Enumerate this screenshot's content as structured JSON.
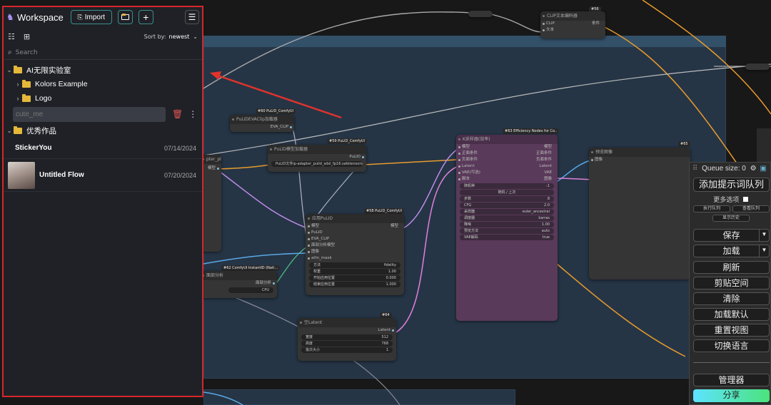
{
  "sidebar": {
    "title": "Workspace",
    "import_label": "Import",
    "sort_label": "Sort by:",
    "sort_value": "newest",
    "search_placeholder": "Search",
    "folders": [
      {
        "label": "AI无限实验室"
      },
      {
        "label": "Kolors Example"
      },
      {
        "label": "Logo"
      },
      {
        "label": "优秀作品"
      }
    ],
    "rename_value": "cute_me",
    "flows": [
      {
        "name": "StickerYou",
        "date": "07/14/2024"
      },
      {
        "name": "Untitled Flow",
        "date": "07/20/2024"
      }
    ]
  },
  "nodes": {
    "clip_encode": {
      "badge": "#56",
      "title": "CLIP文本编码器",
      "in1": "CLIP",
      "in2": "文本",
      "out": "条件"
    },
    "pulid_eva": {
      "badge": "#60 PuLID_ComfyUI",
      "title": "PuLIDEVAClip加载器",
      "out": "EVA_CLIP"
    },
    "pulid_loader": {
      "badge": "#59 PuLID_ComfyUI",
      "title": "PuLID模型加载器",
      "out": "PuLID",
      "widget_label": "PuLID文件",
      "widget_value": "ip-adapter_pulid_sdxl_fp16.safetensors"
    },
    "apply_pulid": {
      "badge": "#58 PuLID_ComfyUI",
      "title": "应用PuLID",
      "inputs": [
        "模型",
        "PuLID",
        "EVA_CLIP",
        "面部分析模型",
        "图像",
        "attn_mask"
      ],
      "out": "模型",
      "widgets": [
        [
          "方法",
          "fidelity"
        ],
        [
          "权重",
          "1.00"
        ],
        [
          "开始应用位置",
          "0.000"
        ],
        [
          "结束应用位置",
          "1.000"
        ]
      ]
    },
    "instantid": {
      "badge": "#62 ComfyUI InstantID (Nati...",
      "title": "面部分析",
      "out": "面部分析",
      "widget_value": "CPU"
    },
    "empty_latent": {
      "badge": "#64",
      "title": "空Latent",
      "out": "Latent",
      "widgets": [
        [
          "宽度",
          "512"
        ],
        [
          "高度",
          "768"
        ],
        [
          "批次大小",
          "1"
        ]
      ]
    },
    "ksampler": {
      "badge": "#63 Efficiency Nodes for Co..",
      "title": "K采样器(效率)",
      "inputs": [
        "模型",
        "正面条件",
        "负面条件",
        "Latent",
        "VAE(可选)",
        "脚本"
      ],
      "outputs": [
        "模型",
        "正面条件",
        "负面条件",
        "Latent",
        "VAE",
        "图像"
      ],
      "seed_label": "随机种",
      "seed_value": "-1",
      "rand_label": "随机 / 上次",
      "widgets": [
        [
          "步数",
          "8"
        ],
        [
          "CFG",
          "2.0"
        ],
        [
          "采样器",
          "euler_ancestral"
        ],
        [
          "调度器",
          "karras"
        ],
        [
          "降噪",
          "1.00"
        ],
        [
          "预览方法",
          "auto"
        ],
        [
          "VAE解码",
          "true"
        ]
      ]
    },
    "preview": {
      "badge": "#65",
      "title": "预览图像",
      "in1": "图像"
    },
    "left_node": {
      "title": "pter_plus",
      "row": "模型"
    }
  },
  "queue": {
    "title": "Queue size: 0",
    "add_prompt": "添加提示词队列",
    "extra_options": "更多选项",
    "run_queue": "执行队列",
    "view_queue": "查看队列",
    "view_history": "显示历史",
    "save": "保存",
    "load": "加载",
    "refresh": "刷新",
    "paste_space": "剪贴空间",
    "clear": "清除",
    "load_default": "加载默认",
    "reset_view": "重置视图",
    "switch_lang": "切换语言",
    "manager": "管理器",
    "share": "分享"
  },
  "colors": {
    "accent": "#3b8f8f",
    "highlight": "#d7262b",
    "share_start": "#5de3ff",
    "share_end": "#4be37c"
  }
}
